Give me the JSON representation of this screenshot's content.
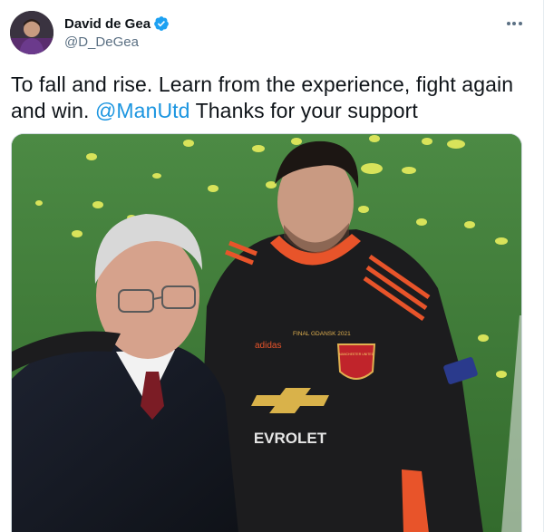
{
  "tweet": {
    "author": {
      "display_name": "David de Gea",
      "handle": "@D_DeGea",
      "verified": true,
      "avatar_icon": "avatar-photo"
    },
    "text_before_mention": "To fall and rise. Learn from the experience, fight again and win.",
    "mention": "@ManUtd",
    "text_after_mention": "Thanks for your support",
    "more_icon": "more-horizontal-icon",
    "media": {
      "kind": "photo",
      "jersey_text": {
        "sponsor": "EVROLET",
        "maker": "adidas",
        "club": "MANCHESTER UNITED",
        "embroidery_title": "FINAL GDANSK 2021"
      }
    }
  },
  "colors": {
    "accent": "#1b95e0",
    "secondary_text": "#5b7083",
    "pitch_green": "#3f7a37",
    "jersey": "#1c1c1e",
    "jersey_stripes": "#e8542a"
  }
}
